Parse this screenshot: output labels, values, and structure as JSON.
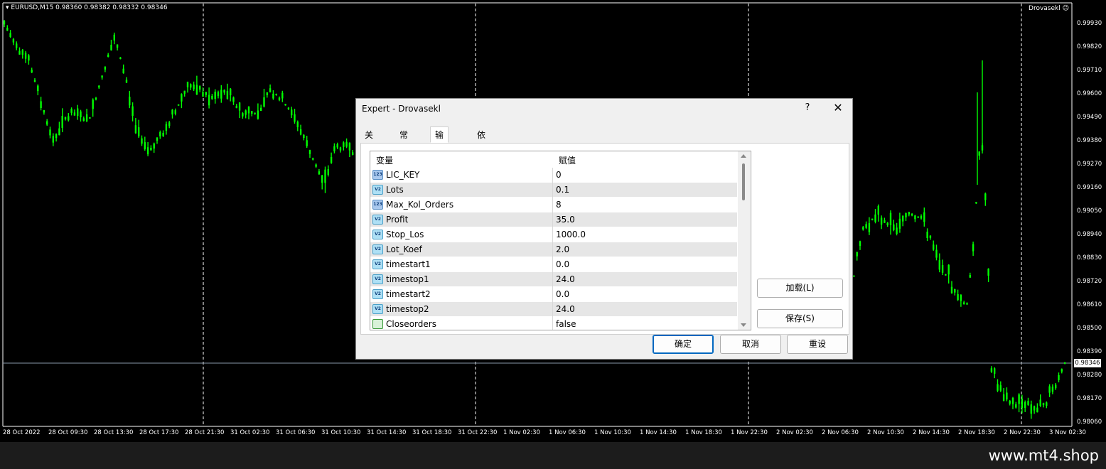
{
  "chart": {
    "symbol_info": "EURUSD,M15  0.98360 0.98382 0.98332 0.98346",
    "expert_label": "Drovasekl",
    "current_price": "0.98346",
    "price_axis": [
      "0.99930",
      "0.99820",
      "0.99710",
      "0.99600",
      "0.99490",
      "0.99380",
      "0.99270",
      "0.99160",
      "0.99050",
      "0.98940",
      "0.98830",
      "0.98720",
      "0.98610",
      "0.98500",
      "0.98390",
      "0.98280",
      "0.98170",
      "0.98060"
    ],
    "time_axis": [
      "28 Oct 2022",
      "28 Oct 09:30",
      "28 Oct 13:30",
      "28 Oct 17:30",
      "28 Oct 21:30",
      "31 Oct 02:30",
      "31 Oct 06:30",
      "31 Oct 10:30",
      "31 Oct 14:30",
      "31 Oct 18:30",
      "31 Oct 22:30",
      "1 Nov 02:30",
      "1 Nov 06:30",
      "1 Nov 10:30",
      "1 Nov 14:30",
      "1 Nov 18:30",
      "1 Nov 22:30",
      "2 Nov 02:30",
      "2 Nov 06:30",
      "2 Nov 10:30",
      "2 Nov 14:30",
      "2 Nov 18:30",
      "2 Nov 22:30",
      "3 Nov 02:30"
    ],
    "colors": {
      "background": "#000000",
      "bars": "#00ff00",
      "grid": "#ffffff"
    }
  },
  "watermark": "www.mt4.shop",
  "dialog": {
    "title": "Expert - Drovasekl",
    "help": "?",
    "close": "✕",
    "tabs": [
      "关于",
      "常用",
      "输入参数",
      "依存关系"
    ],
    "active_tab": "输入参数",
    "columns": [
      "变量",
      "赋值"
    ],
    "params": [
      {
        "name": "LIC_KEY",
        "value": "0",
        "icon": "int-icon"
      },
      {
        "name": "Lots",
        "value": "0.1",
        "icon": "double-icon"
      },
      {
        "name": "Max_Kol_Orders",
        "value": "8",
        "icon": "int-icon"
      },
      {
        "name": "Profit",
        "value": "35.0",
        "icon": "double-icon"
      },
      {
        "name": "Stop_Los",
        "value": "1000.0",
        "icon": "double-icon"
      },
      {
        "name": "Lot_Koef",
        "value": "2.0",
        "icon": "double-icon"
      },
      {
        "name": "timestart1",
        "value": "0.0",
        "icon": "double-icon"
      },
      {
        "name": "timestop1",
        "value": "24.0",
        "icon": "double-icon"
      },
      {
        "name": "timestart2",
        "value": "0.0",
        "icon": "double-icon"
      },
      {
        "name": "timestop2",
        "value": "24.0",
        "icon": "double-icon"
      },
      {
        "name": "Closeorders",
        "value": "false",
        "icon": "bool-icon"
      }
    ],
    "load_button": "加载(L)",
    "save_button": "保存(S)",
    "ok_button": "确定",
    "cancel_button": "取消",
    "reset_button": "重设"
  }
}
